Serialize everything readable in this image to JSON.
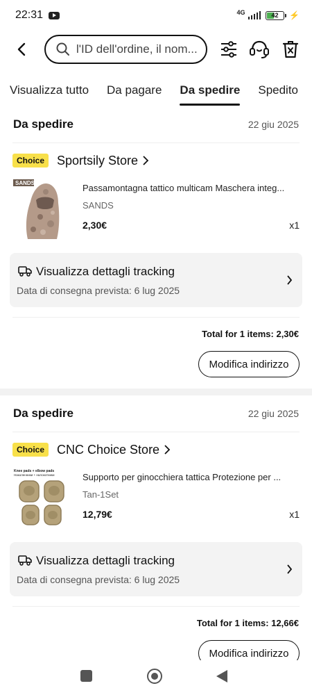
{
  "status_bar": {
    "time": "22:31",
    "network": "4G",
    "battery": "42",
    "battery_fill": 0.42
  },
  "search": {
    "placeholder": "l'ID dell'ordine, il nom..."
  },
  "tabs": [
    {
      "label": "Visualizza tutto",
      "active": false
    },
    {
      "label": "Da pagare",
      "active": false
    },
    {
      "label": "Da spedire",
      "active": true
    },
    {
      "label": "Spedito",
      "active": false
    }
  ],
  "orders": [
    {
      "status": "Da spedire",
      "date": "22 giu 2025",
      "badge": "Choice",
      "store": "Sportsily Store",
      "product": {
        "title": "Passamontagna tattico multicam Maschera integ...",
        "variant": "SANDS",
        "price": "2,30€",
        "qty": "x1",
        "thumb_label": "SANDS"
      },
      "tracking": {
        "title": "Visualizza dettagli tracking",
        "date": "Data di consegna prevista: 6 lug 2025"
      },
      "total": "Total for 1 items: 2,30€",
      "button": "Modifica indirizzo"
    },
    {
      "status": "Da spedire",
      "date": "22 giu 2025",
      "badge": "Choice",
      "store": "CNC Choice Store",
      "product": {
        "title": "Supporto per ginocchiera tattica Protezione per ...",
        "variant": "Tan-1Set",
        "price": "12,79€",
        "qty": "x1",
        "thumb_label_1": "Knee pads + elbow pads",
        "thumb_label_2": "Наколенники + налокотники"
      },
      "tracking": {
        "title": "Visualizza dettagli tracking",
        "date": "Data di consegna prevista: 6 lug 2025"
      },
      "total": "Total for 1 items: 12,66€",
      "button": "Modifica indirizzo"
    }
  ],
  "colors": {
    "choice_badge": "#f8e04a",
    "tracking_bg": "#f3f3f3",
    "battery": "#4caf50"
  }
}
